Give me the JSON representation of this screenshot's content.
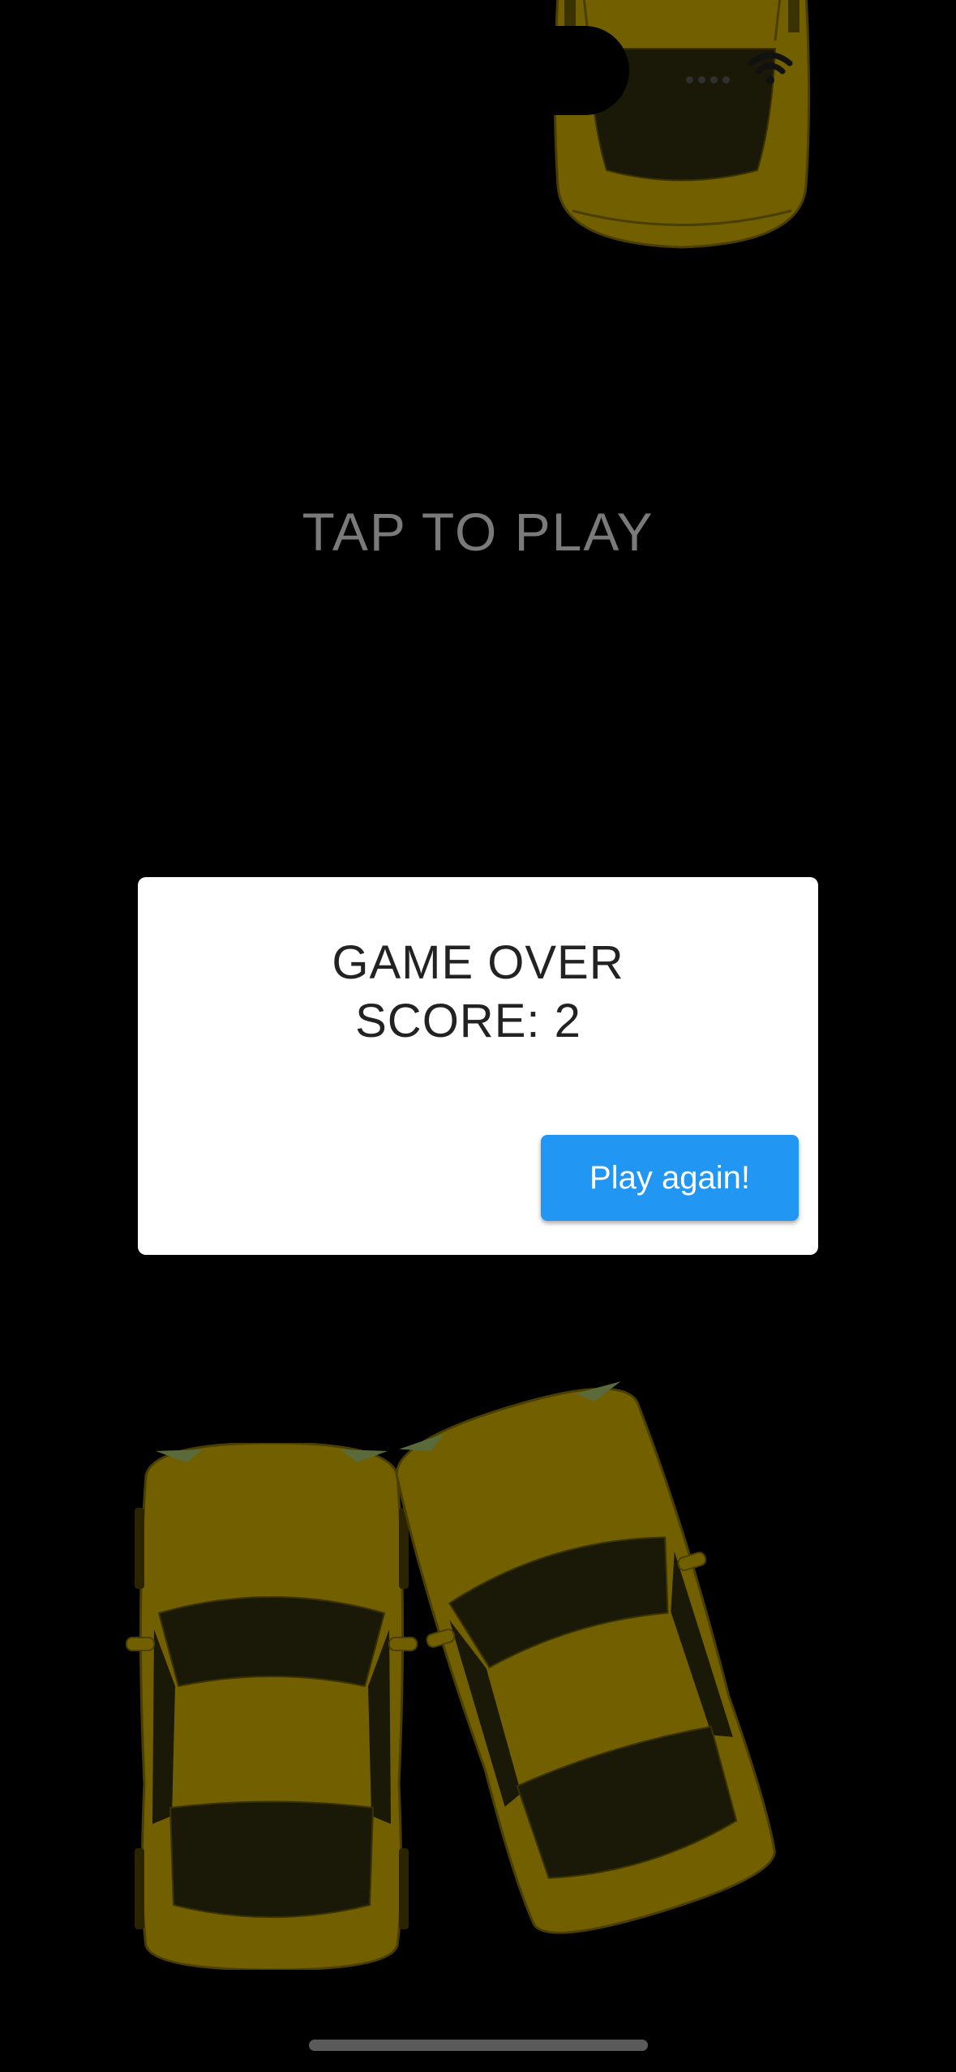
{
  "game": {
    "prompt": "TAP TO PLAY"
  },
  "dialog": {
    "title": "GAME OVER",
    "score_text": "SCORE: 2",
    "button_label": "Play again!"
  },
  "colors": {
    "background": "#000000",
    "car_body": "#726000",
    "car_window": "#1a1806",
    "dialog_bg": "#ffffff",
    "button_bg": "#2196f3",
    "prompt_text": "#7a7a7a"
  },
  "cars": [
    {
      "name": "yellow-car-top"
    },
    {
      "name": "yellow-car-bottom-left"
    },
    {
      "name": "yellow-car-bottom-right"
    }
  ]
}
